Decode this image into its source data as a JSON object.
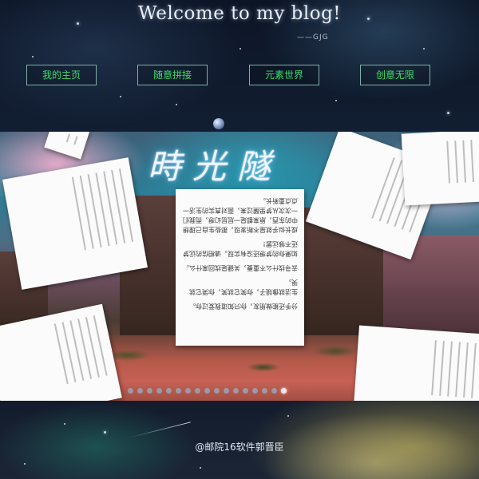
{
  "header": {
    "title": "Welcome to my blog!",
    "signature": "——GJG"
  },
  "nav": {
    "items": [
      {
        "label": "我的主页"
      },
      {
        "label": "随意拼接"
      },
      {
        "label": "元素世界"
      },
      {
        "label": "创意无限"
      }
    ]
  },
  "banner": {
    "art_text": "時光隧",
    "main_card": {
      "paragraphs": [
        "成长似乎就是不断发现，那些生自己理想中的东西，原来都是一层层幻想，而我们一次次从梦里醒过来，面对真实的生活一点点重新长。",
        "如果你的梦想还没有实现，请相信的远梦还不够远罢！",
        "去寻找什么不重要，关键是找回来什么。",
        "生活就像镜子，你笑它就笑，你哭它就哭。",
        "分手还能做朋友，你只知道我爱过你。"
      ]
    },
    "slide_count": 17,
    "active_slide": 16
  },
  "footer": {
    "text": "@邮院16软件郭晋臣"
  },
  "colors": {
    "nav_text": "#3fdc6a",
    "nav_border": "#7fb0a8"
  }
}
